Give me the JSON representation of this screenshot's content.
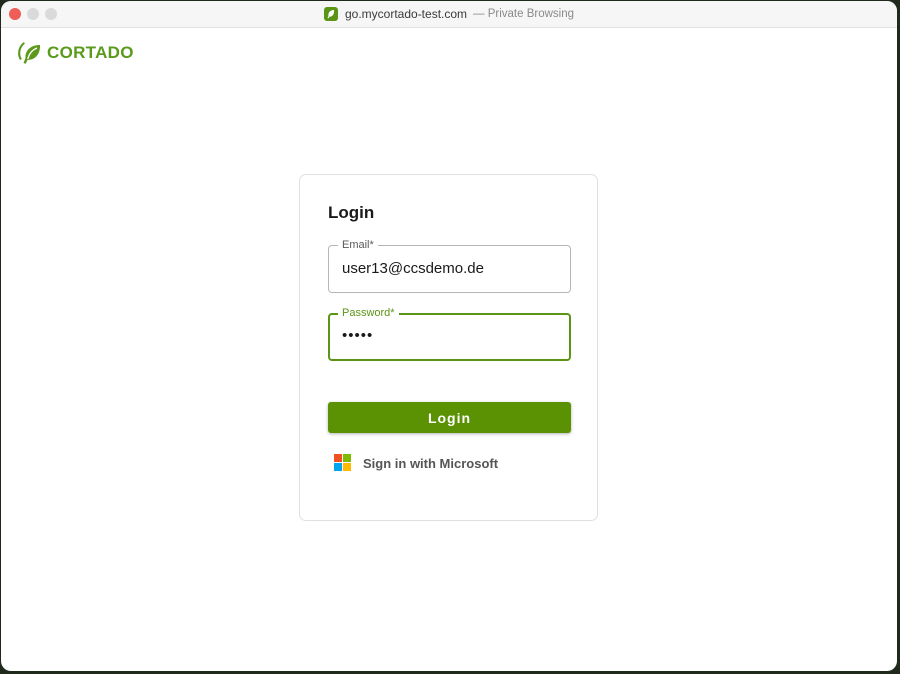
{
  "browser": {
    "url": "go.mycortado-test.com",
    "mode_label": "— Private Browsing"
  },
  "brand": {
    "name": "CORTADO",
    "color": "#5b9a1c"
  },
  "login": {
    "title": "Login",
    "email": {
      "label": "Email*",
      "value": "user13@ccsdemo.de"
    },
    "password": {
      "label": "Password*",
      "value": "•••••"
    },
    "submit_label": "Login",
    "microsoft_label": "Sign in with Microsoft"
  },
  "colors": {
    "accent": "#5b9204",
    "ms_red": "#f25022",
    "ms_green": "#7fba00",
    "ms_blue": "#00a4ef",
    "ms_yellow": "#ffb900"
  }
}
